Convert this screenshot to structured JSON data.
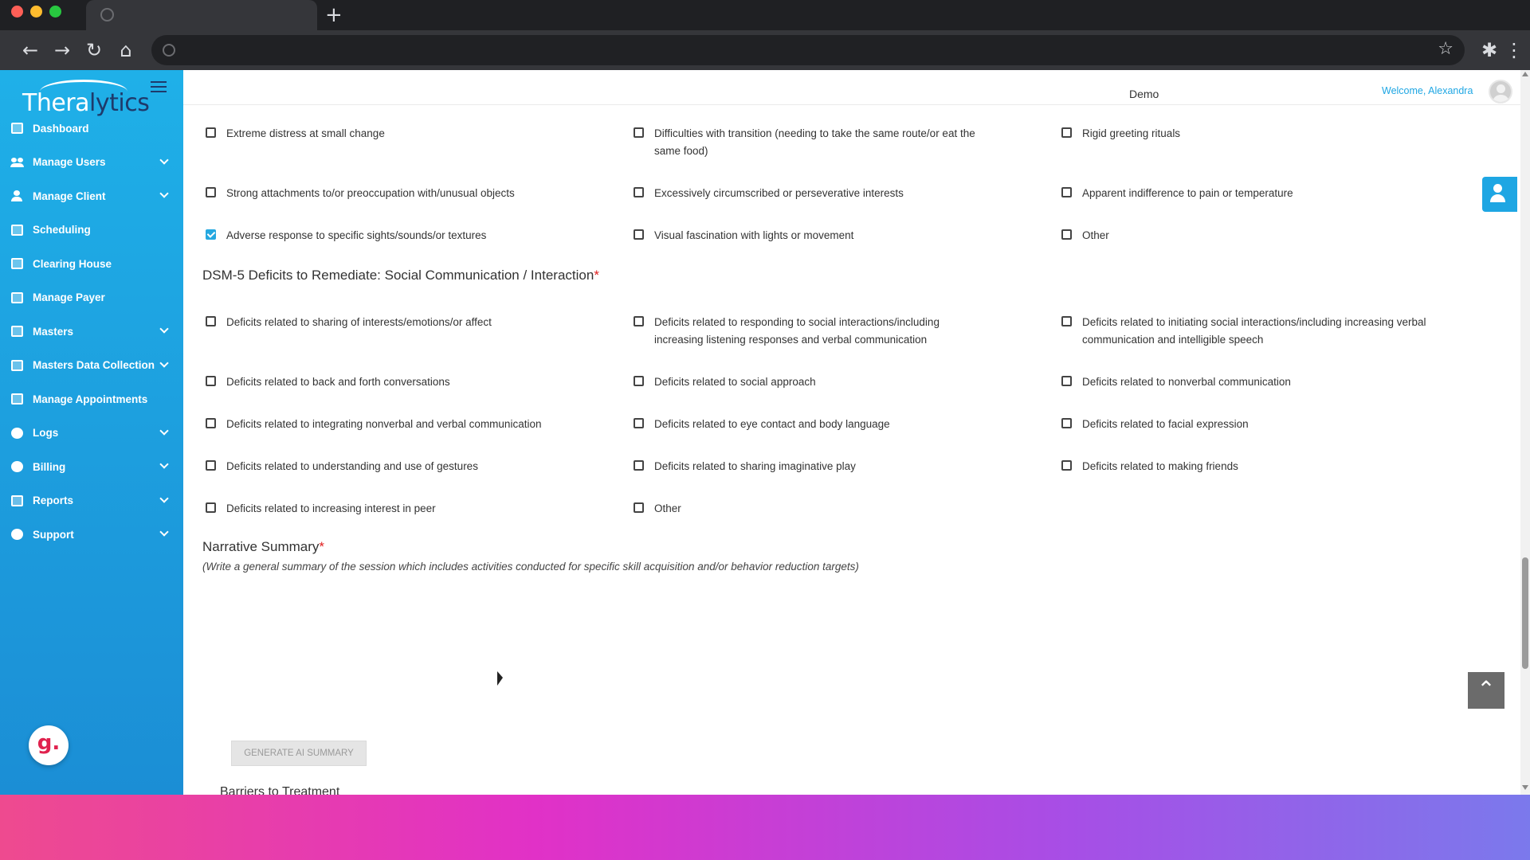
{
  "browser": {
    "new_tab_symbol": "+"
  },
  "brand": {
    "name_main": "Thera",
    "name_accent": "lytics"
  },
  "sidebar": {
    "items": [
      {
        "label": "Dashboard",
        "icon": "dashboard-icon",
        "has_submenu": false
      },
      {
        "label": "Manage Users",
        "icon": "users-icon",
        "has_submenu": true
      },
      {
        "label": "Manage Client",
        "icon": "user-icon",
        "has_submenu": true
      },
      {
        "label": "Scheduling",
        "icon": "calendar-icon",
        "has_submenu": false
      },
      {
        "label": "Clearing House",
        "icon": "id-card-icon",
        "has_submenu": false
      },
      {
        "label": "Manage Payer",
        "icon": "payer-icon",
        "has_submenu": false
      },
      {
        "label": "Masters",
        "icon": "database-icon",
        "has_submenu": true
      },
      {
        "label": "Masters Data Collection",
        "icon": "file-icon",
        "has_submenu": true
      },
      {
        "label": "Manage Appointments",
        "icon": "appointments-icon",
        "has_submenu": false
      },
      {
        "label": "Logs",
        "icon": "history-icon",
        "has_submenu": true
      },
      {
        "label": "Billing",
        "icon": "dollar-icon",
        "has_submenu": true
      },
      {
        "label": "Reports",
        "icon": "report-icon",
        "has_submenu": true
      },
      {
        "label": "Support",
        "icon": "help-icon",
        "has_submenu": true
      }
    ],
    "badge_letter": "g."
  },
  "header": {
    "org": "Demo",
    "welcome": "Welcome, Alexandra"
  },
  "restricted_behaviors": [
    {
      "label": "Extreme distress at small change",
      "checked": false
    },
    {
      "label": "Difficulties with transition (needing to take the same route/or eat the same food)",
      "checked": false
    },
    {
      "label": "Rigid greeting rituals",
      "checked": false
    },
    {
      "label": "Strong attachments to/or preoccupation with/unusual objects",
      "checked": false
    },
    {
      "label": "Excessively circumscribed or perseverative interests",
      "checked": false
    },
    {
      "label": "Apparent indifference to pain or temperature",
      "checked": false
    },
    {
      "label": "Adverse response to specific sights/sounds/or textures",
      "checked": true
    },
    {
      "label": "Visual fascination with lights or movement",
      "checked": false
    },
    {
      "label": "Other",
      "checked": false
    }
  ],
  "social_section": {
    "title": "DSM-5 Deficits to Remediate: Social Communication / Interaction",
    "required_mark": "*",
    "items": [
      {
        "label": "Deficits related to sharing of interests/emotions/or affect",
        "checked": false
      },
      {
        "label": "Deficits related to responding to social interactions/including increasing listening responses and verbal communication",
        "checked": false
      },
      {
        "label": "Deficits related to initiating social interactions/including increasing verbal communication and intelligible speech",
        "checked": false
      },
      {
        "label": "Deficits related to back and forth conversations",
        "checked": false
      },
      {
        "label": "Deficits related to social approach",
        "checked": false
      },
      {
        "label": "Deficits related to nonverbal communication",
        "checked": false
      },
      {
        "label": "Deficits related to integrating nonverbal and verbal communication",
        "checked": false
      },
      {
        "label": "Deficits related to eye contact and body language",
        "checked": false
      },
      {
        "label": "Deficits related to facial expression",
        "checked": false
      },
      {
        "label": "Deficits related to understanding and use of gestures",
        "checked": false
      },
      {
        "label": "Deficits related to sharing imaginative play",
        "checked": false
      },
      {
        "label": "Deficits related to making friends",
        "checked": false
      },
      {
        "label": "Deficits related to increasing interest in peer",
        "checked": false
      },
      {
        "label": "Other",
        "checked": false
      }
    ]
  },
  "narrative": {
    "title": "Narrative Summary",
    "required_mark": "*",
    "note": "(Write a general summary of the session which includes activities conducted for specific skill acquisition and/or behavior reduction targets)",
    "button": "GENERATE AI SUMMARY"
  },
  "next_section": {
    "title": "Barriers to Treatment"
  },
  "colors": {
    "accent": "#1ea6e3",
    "sidebar_top": "#1fb0e8",
    "sidebar_bottom": "#1b8ed5",
    "required": "#e02020"
  },
  "controls": {
    "scroll_top_symbol": "⌃"
  }
}
